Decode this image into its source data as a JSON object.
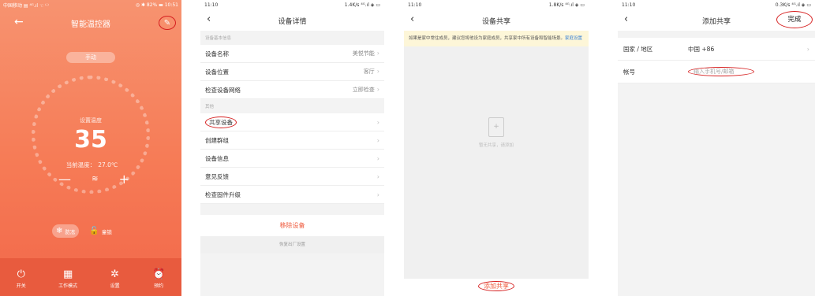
{
  "thermostat": {
    "status": {
      "left": "中国移动 ▤ ⁴ᴳ.ıl ☜ ⁽ᐧ⁾",
      "right": "◎ ✱ 82% ▬ 10:51"
    },
    "title": "智能温控器",
    "mode": "手动",
    "set_label": "设置温度",
    "set_value": "35",
    "current_label": "当前温度：",
    "current_value": "27.0℃",
    "functions": [
      {
        "label": "防冻",
        "icon": "snowflake-icon",
        "glyph": "❄"
      },
      {
        "label": "童锁",
        "icon": "lock-icon",
        "glyph": "🔓"
      }
    ],
    "nav": [
      {
        "label": "开关",
        "icon": "power-icon",
        "glyph": "⏻"
      },
      {
        "label": "工作模式",
        "icon": "grid-icon",
        "glyph": "▦"
      },
      {
        "label": "设置",
        "icon": "gear-icon",
        "glyph": "✲"
      },
      {
        "label": "预约",
        "icon": "clock-icon",
        "glyph": "⏰"
      }
    ]
  },
  "details": {
    "status": {
      "time": "11:10",
      "right": "1.4K/s ⁴ᴳ.ıl ◈ ▭"
    },
    "title": "设备详情",
    "section1": "设备基本信息",
    "rows1": [
      {
        "label": "设备名称",
        "value": "美悦节能"
      },
      {
        "label": "设备位置",
        "value": "客厅"
      },
      {
        "label": "检查设备网络",
        "value": "立即检查"
      }
    ],
    "section2": "其他",
    "rows2": [
      {
        "label": "共享设备"
      },
      {
        "label": "创建群组"
      },
      {
        "label": "设备信息"
      },
      {
        "label": "意见反馈"
      },
      {
        "label": "检查固件升级"
      }
    ],
    "remove": "移除设备",
    "reset": "恢复出厂设置"
  },
  "share": {
    "status": {
      "time": "11:10",
      "right": "1.8K/s ⁴ᴳ.ıl ◈ ▭"
    },
    "title": "设备共享",
    "notice": "如果是家中常住成员，建议您将他设为家庭成员，共享家中所有设备和智能场景。",
    "notice_link": "家庭设置",
    "empty_text": "暂无共享，请添加",
    "add_button": "添加共享"
  },
  "add_share": {
    "status": {
      "time": "11:10",
      "right": "0.3K/s ⁴ᴳ.ıl ◈ ▭"
    },
    "title": "添加共享",
    "done": "完成",
    "region_label": "国家 / 地区",
    "region_value": "中国 +86",
    "account_label": "帐号",
    "account_placeholder": "输入手机号/邮箱"
  },
  "colors": {
    "accent": "#ef5b3e",
    "annotation": "#d62020",
    "notice_bg": "#fdf6d8"
  }
}
